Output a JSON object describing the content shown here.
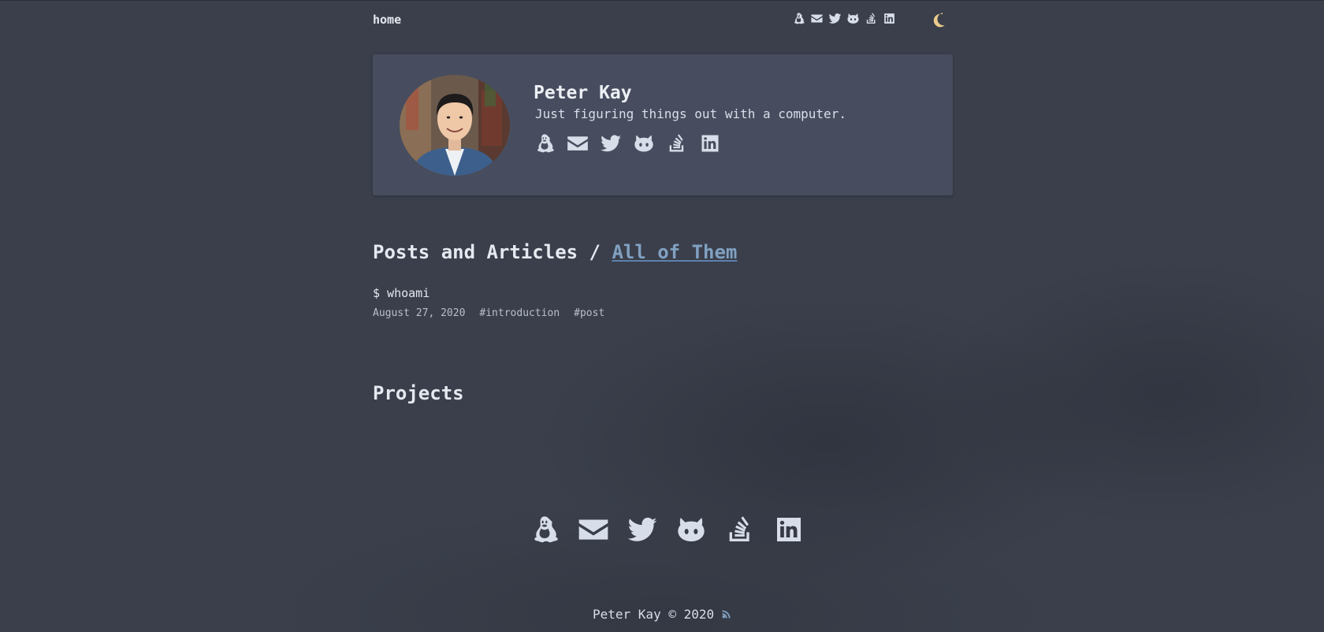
{
  "nav": {
    "home_label": "home",
    "icons": [
      "linux-icon",
      "email-icon",
      "twitter-icon",
      "github-icon",
      "stackoverflow-icon",
      "linkedin-icon"
    ],
    "theme_toggle_icon": "moon-icon"
  },
  "profile": {
    "name": "Peter Kay",
    "bio": "Just figuring things out with a computer."
  },
  "posts": {
    "heading": "Posts and Articles /",
    "all_link": "All of Them",
    "items": [
      {
        "title": "$ whoami",
        "date": "August 27, 2020",
        "tags": [
          "#introduction",
          "#post"
        ]
      }
    ]
  },
  "projects": {
    "heading": "Projects"
  },
  "footer": {
    "copyright": "Peter Kay © 2020",
    "rss_icon": "rss-icon"
  },
  "colors": {
    "background": "#3a3f4b",
    "card": "#474d5e",
    "text": "#d8dee9",
    "link": "#81a1c1",
    "moon": "#ebcb8b",
    "rss": "#81a1c1"
  }
}
